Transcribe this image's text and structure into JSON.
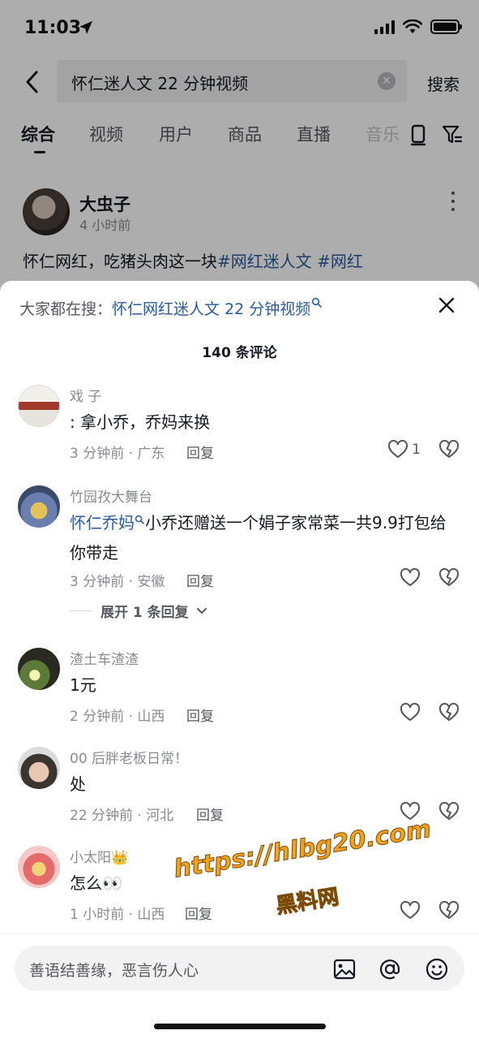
{
  "status_bar": {
    "time": "11:03"
  },
  "search": {
    "query": "怀仁迷人文 22 分钟视频",
    "submit_label": "搜索"
  },
  "tabs": [
    {
      "label": "综合"
    },
    {
      "label": "视频"
    },
    {
      "label": "用户"
    },
    {
      "label": "商品"
    },
    {
      "label": "直播"
    },
    {
      "label": "音乐"
    }
  ],
  "feed_post": {
    "author": "大虫子",
    "time": "4 小时前",
    "text": "怀仁网红，吃猪头肉这一块",
    "tags": "#网红迷人文 #网红"
  },
  "sheet": {
    "suggest_label": "大家都在搜：",
    "suggest_query": "怀仁网红迷人文 22 分钟视频",
    "comment_count": "140 条评论"
  },
  "comments": [
    {
      "name": "戏  子",
      "mention": "",
      "text": ": 拿小乔，乔妈来换",
      "meta": "3 分钟前 · 广东",
      "reply": "回复",
      "likes": "1"
    },
    {
      "name": "竹园孜大舞台",
      "mention": "怀仁乔妈",
      "text": "小乔还赠送一个娟子家常菜一共9.9打包给你带走",
      "meta": "3 分钟前 · 安徽",
      "reply": "回复",
      "likes": "",
      "expand": "展开 1 条回复"
    },
    {
      "name": "渣土车渣渣",
      "mention": "",
      "text": "1元",
      "meta": "2 分钟前 · 山西",
      "reply": "回复",
      "likes": ""
    },
    {
      "name": "00 后胖老板日常！",
      "mention": "",
      "text": "处",
      "meta": "22 分钟前 · 河北",
      "reply": "回复",
      "likes": ""
    },
    {
      "name": "小太阳👑",
      "mention": "",
      "text": "怎么👀",
      "meta": "1 小时前 · 山西",
      "reply": "回复",
      "likes": ""
    }
  ],
  "watermark": {
    "url": "https://hlbg20.com",
    "label": "黑料网"
  },
  "input": {
    "placeholder": "善语结善缘，恶言伤人心"
  },
  "icons": {
    "back": "chevron-left-icon",
    "clear": "clear-circle-icon",
    "filter": "filter-icon",
    "more": "more-vertical-icon",
    "close": "close-icon",
    "like": "heart-icon",
    "dislike": "broken-heart-icon",
    "image": "image-icon",
    "mention": "at-icon",
    "emoji": "emoji-icon"
  },
  "colors": {
    "link": "#2a5a9a",
    "watermark": "#f4a21c",
    "overlay": "rgba(0,0,0,0.32)"
  }
}
